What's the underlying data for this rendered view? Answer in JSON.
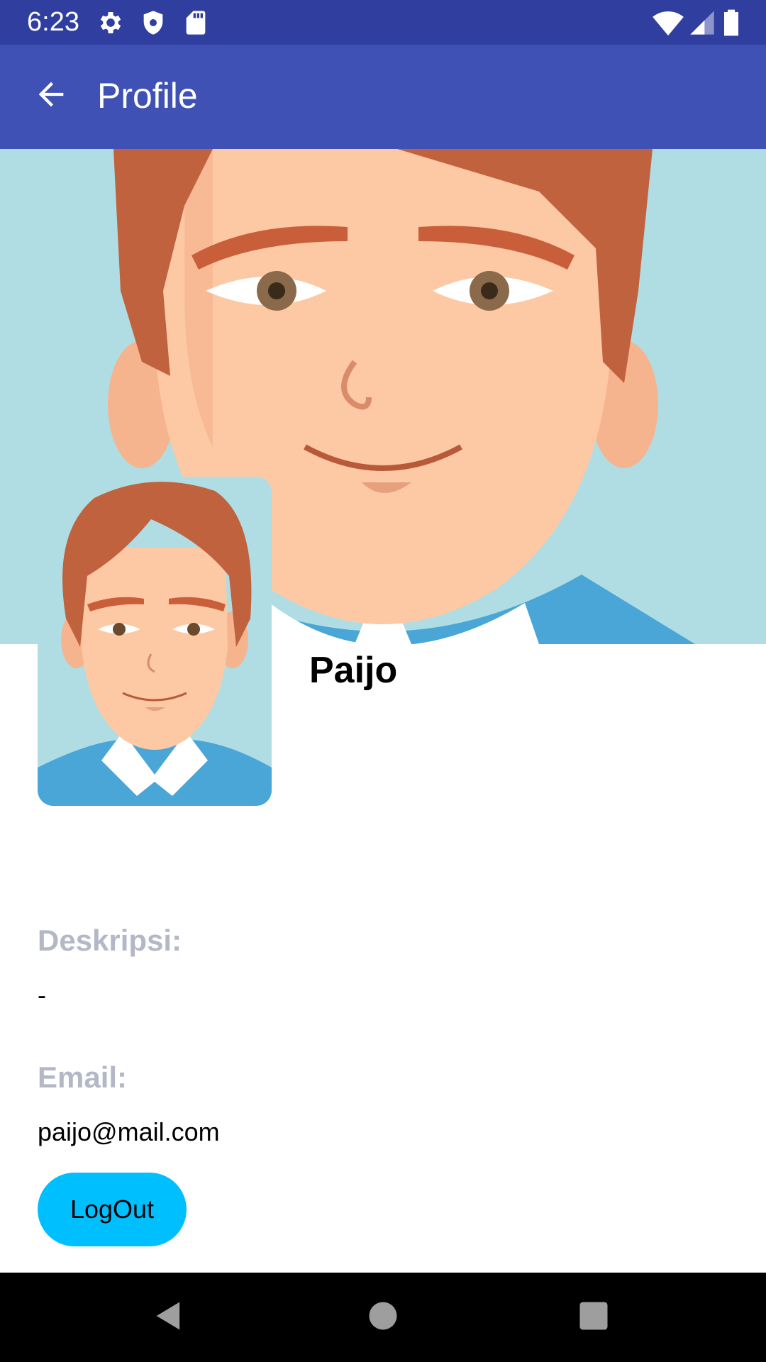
{
  "status_bar": {
    "time": "6:23",
    "icons": [
      "gear-icon",
      "shield-icon",
      "sd-card-icon",
      "wifi-icon",
      "signal-icon",
      "battery-icon"
    ]
  },
  "app_bar": {
    "title": "Profile",
    "back_icon": "arrow-back-icon"
  },
  "profile": {
    "name": "Paijo",
    "description_label": "Deskripsi:",
    "description_value": "-",
    "email_label": "Email:",
    "email_value": "paijo@mail.com",
    "logout_label": "LogOut"
  },
  "colors": {
    "status_bar": "#303f9f",
    "app_bar": "#3f51b5",
    "cover_bg": "#afdde3",
    "label": "#b4b8c6",
    "logout_button": "#00bfff"
  },
  "nav_bar": {
    "icons": [
      "back-triangle-icon",
      "home-circle-icon",
      "recents-square-icon"
    ]
  }
}
